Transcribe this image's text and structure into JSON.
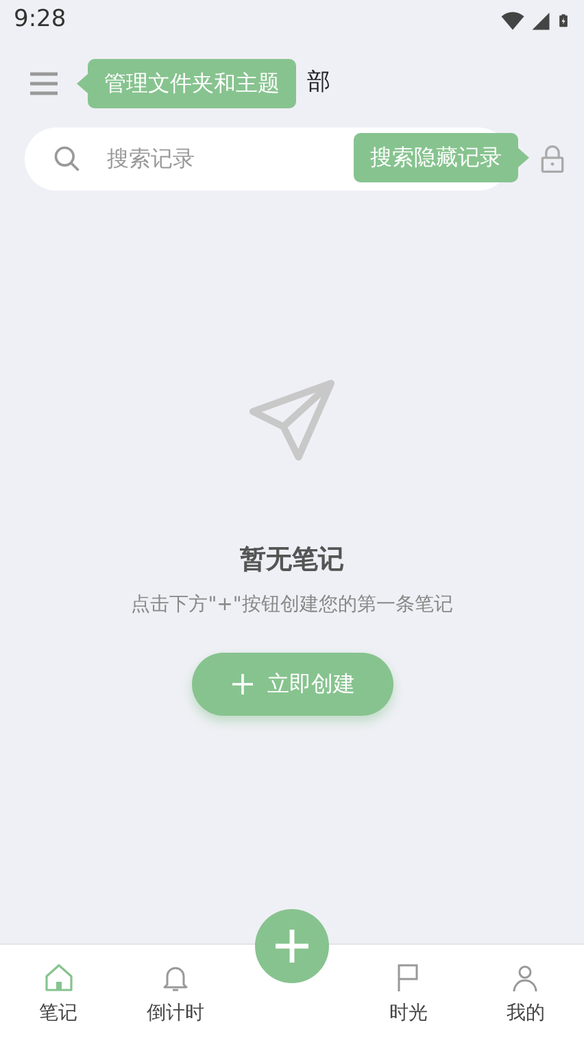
{
  "status_bar": {
    "time": "9:28"
  },
  "header": {
    "title_visible": "部",
    "menu_tooltip": "管理文件夹和主题"
  },
  "search": {
    "placeholder": "搜索记录",
    "lock_tooltip": "搜索隐藏记录"
  },
  "empty_state": {
    "title": "暂无笔记",
    "message": "点击下方\"+\"按钮创建您的第一条笔记",
    "button": "立即创建"
  },
  "bottom_nav": [
    {
      "kind": "tab",
      "label": "笔记",
      "selected": true
    },
    {
      "kind": "tab",
      "label": "倒计时",
      "selected": false
    },
    {
      "kind": "fab"
    },
    {
      "kind": "tab",
      "label": "时光",
      "selected": false
    },
    {
      "kind": "tab",
      "label": "我的",
      "selected": false
    }
  ]
}
